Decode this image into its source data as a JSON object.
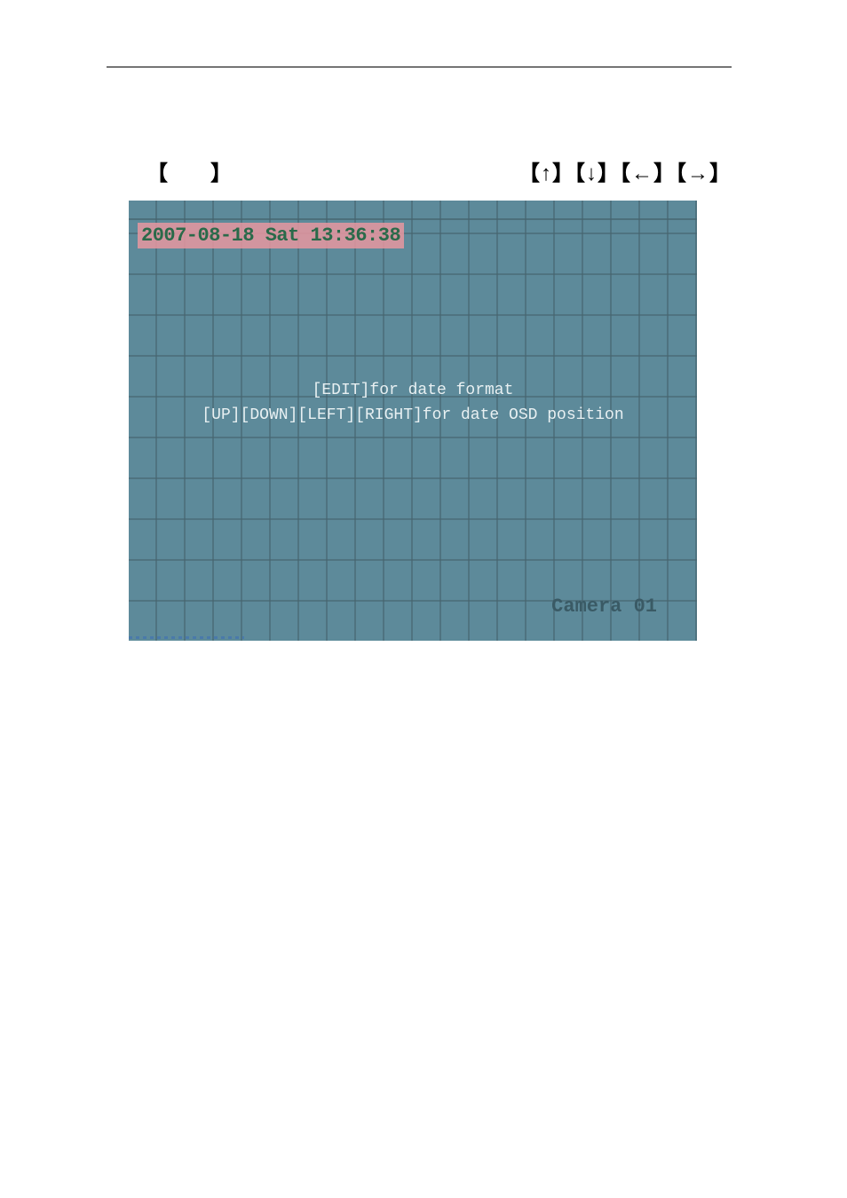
{
  "brackets": {
    "left": "【　　】",
    "right": "【↑】【↓】【←】【→】"
  },
  "osd": {
    "datetime": "2007-08-18 Sat 13:36:38",
    "instruction_line1": "[EDIT]for date format",
    "instruction_line2": "[UP][DOWN][LEFT][RIGHT]for date OSD position",
    "camera_label": "Camera 01"
  }
}
